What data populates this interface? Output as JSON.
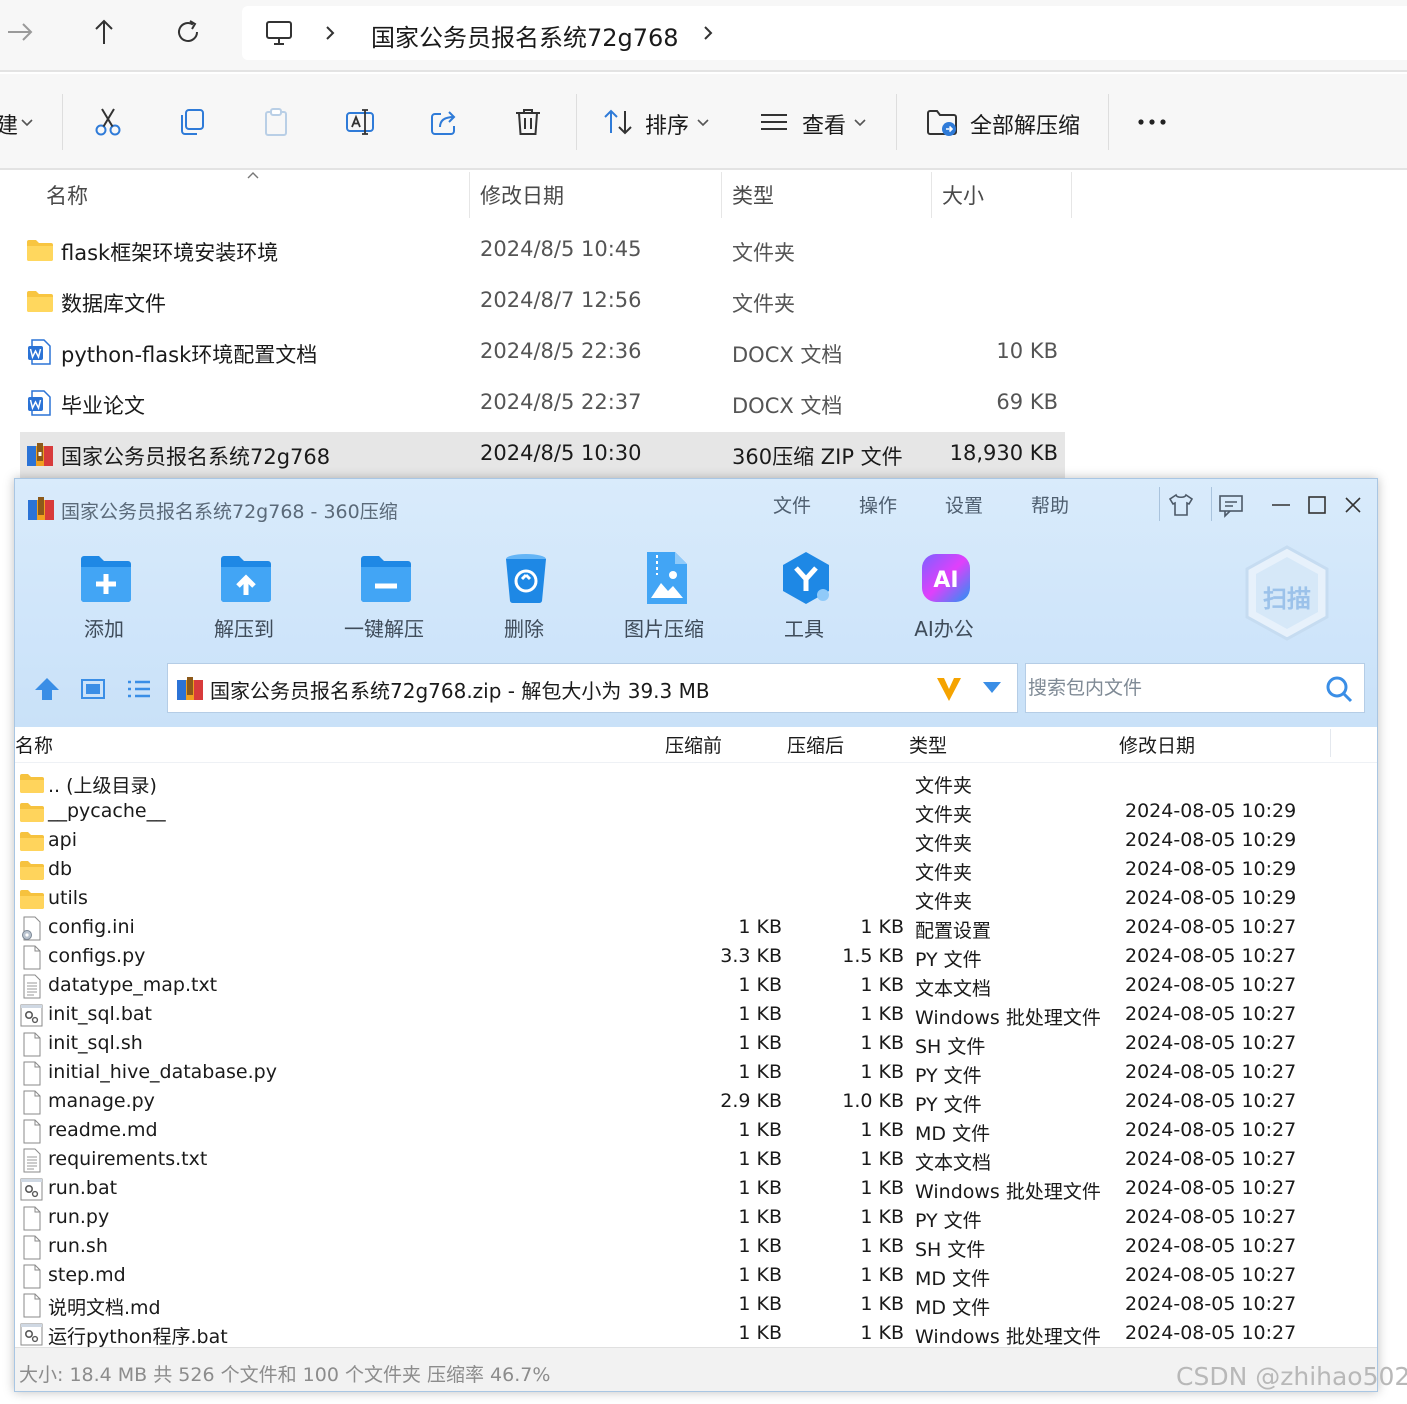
{
  "explorer": {
    "breadcrumb": "国家公务员报名系统72g768",
    "toolbar": {
      "new_partial": "建",
      "sort_label": "排序",
      "view_label": "查看",
      "extract_all_label": "全部解压缩"
    },
    "columns": {
      "name": "名称",
      "modified": "修改日期",
      "type": "类型",
      "size": "大小"
    },
    "files": [
      {
        "name": "flask框架环境安装环境",
        "modified": "2024/8/5 10:45",
        "type": "文件夹",
        "size": ""
      },
      {
        "name": "数据库文件",
        "modified": "2024/8/7 12:56",
        "type": "文件夹",
        "size": ""
      },
      {
        "name": "python-flask环境配置文档",
        "modified": "2024/8/5 22:36",
        "type": "DOCX 文档",
        "size": "10 KB"
      },
      {
        "name": "毕业论文",
        "modified": "2024/8/5 22:37",
        "type": "DOCX 文档",
        "size": "69 KB"
      },
      {
        "name": "国家公务员报名系统72g768",
        "modified": "2024/8/5 10:30",
        "type": "360压缩 ZIP 文件",
        "size": "18,930 KB"
      }
    ]
  },
  "zip360": {
    "title": "国家公务员报名系统72g768 - 360压缩",
    "menu": [
      "文件",
      "操作",
      "设置",
      "帮助"
    ],
    "tools": [
      "添加",
      "解压到",
      "一键解压",
      "删除",
      "图片压缩",
      "工具",
      "AI办公"
    ],
    "scan_label": "扫描",
    "ai_icon_text": "AI",
    "path_text": "国家公务员报名系统72g768.zip - 解包大小为 39.3 MB",
    "search_placeholder": "搜索包内文件",
    "columns": {
      "name": "名称",
      "before": "压缩前",
      "after": "压缩后",
      "type": "类型",
      "modified": "修改日期"
    },
    "rows": [
      {
        "name": ".. (上级目录)",
        "before": "",
        "after": "",
        "type": "文件夹",
        "modified": "",
        "icon": "folder"
      },
      {
        "name": "__pycache__",
        "before": "",
        "after": "",
        "type": "文件夹",
        "modified": "2024-08-05 10:29",
        "icon": "folder"
      },
      {
        "name": "api",
        "before": "",
        "after": "",
        "type": "文件夹",
        "modified": "2024-08-05 10:29",
        "icon": "folder"
      },
      {
        "name": "db",
        "before": "",
        "after": "",
        "type": "文件夹",
        "modified": "2024-08-05 10:29",
        "icon": "folder"
      },
      {
        "name": "utils",
        "before": "",
        "after": "",
        "type": "文件夹",
        "modified": "2024-08-05 10:29",
        "icon": "folder"
      },
      {
        "name": "config.ini",
        "before": "1 KB",
        "after": "1 KB",
        "type": "配置设置",
        "modified": "2024-08-05 10:27",
        "icon": "ini"
      },
      {
        "name": "configs.py",
        "before": "3.3 KB",
        "after": "1.5 KB",
        "type": "PY 文件",
        "modified": "2024-08-05 10:27",
        "icon": "file"
      },
      {
        "name": "datatype_map.txt",
        "before": "1 KB",
        "after": "1 KB",
        "type": "文本文档",
        "modified": "2024-08-05 10:27",
        "icon": "text"
      },
      {
        "name": "init_sql.bat",
        "before": "1 KB",
        "after": "1 KB",
        "type": "Windows 批处理文件",
        "modified": "2024-08-05 10:27",
        "icon": "bat"
      },
      {
        "name": "init_sql.sh",
        "before": "1 KB",
        "after": "1 KB",
        "type": "SH 文件",
        "modified": "2024-08-05 10:27",
        "icon": "file"
      },
      {
        "name": "initial_hive_database.py",
        "before": "1 KB",
        "after": "1 KB",
        "type": "PY 文件",
        "modified": "2024-08-05 10:27",
        "icon": "file"
      },
      {
        "name": "manage.py",
        "before": "2.9 KB",
        "after": "1.0 KB",
        "type": "PY 文件",
        "modified": "2024-08-05 10:27",
        "icon": "file"
      },
      {
        "name": "readme.md",
        "before": "1 KB",
        "after": "1 KB",
        "type": "MD 文件",
        "modified": "2024-08-05 10:27",
        "icon": "file"
      },
      {
        "name": "requirements.txt",
        "before": "1 KB",
        "after": "1 KB",
        "type": "文本文档",
        "modified": "2024-08-05 10:27",
        "icon": "text"
      },
      {
        "name": "run.bat",
        "before": "1 KB",
        "after": "1 KB",
        "type": "Windows 批处理文件",
        "modified": "2024-08-05 10:27",
        "icon": "bat"
      },
      {
        "name": "run.py",
        "before": "1 KB",
        "after": "1 KB",
        "type": "PY 文件",
        "modified": "2024-08-05 10:27",
        "icon": "file"
      },
      {
        "name": "run.sh",
        "before": "1 KB",
        "after": "1 KB",
        "type": "SH 文件",
        "modified": "2024-08-05 10:27",
        "icon": "file"
      },
      {
        "name": "step.md",
        "before": "1 KB",
        "after": "1 KB",
        "type": "MD 文件",
        "modified": "2024-08-05 10:27",
        "icon": "file"
      },
      {
        "name": "说明文档.md",
        "before": "1 KB",
        "after": "1 KB",
        "type": "MD 文件",
        "modified": "2024-08-05 10:27",
        "icon": "file"
      },
      {
        "name": "运行python程序.bat",
        "before": "1 KB",
        "after": "1 KB",
        "type": "Windows 批处理文件",
        "modified": "2024-08-05 10:27",
        "icon": "bat"
      }
    ],
    "status": "大小: 18.4 MB 共 526 个文件和 100 个文件夹 压缩率 46.7%"
  },
  "watermark": "CSDN @zhihao502",
  "colors": {
    "accent": "#2f8fe0",
    "selection": "#e6e6e6",
    "folder": "#f9c53a",
    "zip360_bg": "#d4e8fb"
  }
}
